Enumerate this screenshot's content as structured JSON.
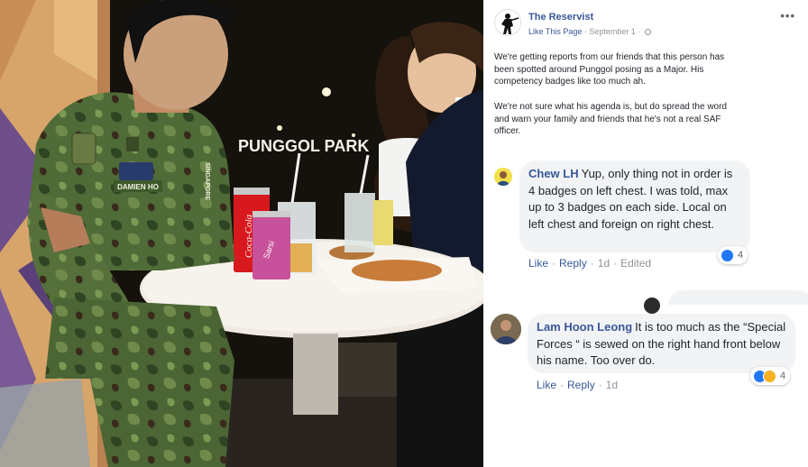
{
  "photo": {
    "sign_text": "PUNGGOL PARK",
    "name_tape": "DAMIEN HO",
    "shoulder_tape": "SINGAPORE",
    "can_brand": "Coca-Cola",
    "can2_brand": "Sarsi"
  },
  "post": {
    "page_name": "The Reservist",
    "like_page": "Like This Page",
    "separator": "·",
    "date": "September 1",
    "more": "•••",
    "paragraphs": [
      "We're getting reports from our friends that this person has been spotted around Punggol posing as a Major. His competency badges like too much ah.",
      "We're not sure what his agenda is, but do spread the word and warn your family and friends that he's not a real SAF officer."
    ]
  },
  "comments": [
    {
      "author": "Chew LH",
      "text": "Yup, only thing not in order is 4 badges on left chest. I was told, max up to 3 badges on each side. Local on left chest and foreign on right chest.",
      "actions": {
        "like": "Like",
        "reply": "Reply",
        "time": "1d",
        "edited": "Edited"
      },
      "reaction_count": "4",
      "reaction_types": [
        "like"
      ]
    },
    {
      "author": "Lam Hoon Leong",
      "text": "It is too much as the “Special Forces “ is sewed on the right hand front below his name. Too over do.",
      "actions": {
        "like": "Like",
        "reply": "Reply",
        "time": "1d"
      },
      "reaction_count": "4",
      "reaction_types": [
        "like",
        "haha"
      ]
    }
  ],
  "colors": {
    "link": "#385898",
    "bubble": "#f2f3f5",
    "text": "#1d2129",
    "muted": "#90949c",
    "like_blue": "#2078f4",
    "haha_yellow": "#f7b125"
  }
}
